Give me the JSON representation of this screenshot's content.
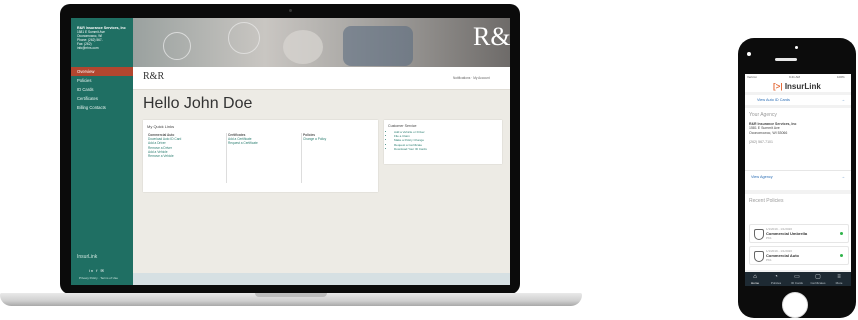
{
  "laptop": {
    "sidebar": {
      "brand_name": "R&R Insurance Services, Inc",
      "brand_lines": [
        "1581 E Summit Ave",
        "Oconomowoc, WI",
        "Phone: (262) 567-",
        "Fax: (262)",
        "info@rrins.com"
      ],
      "items": [
        {
          "label": "Overview",
          "active": true
        },
        {
          "label": "Policies",
          "active": false
        },
        {
          "label": "ID Cards",
          "active": false
        },
        {
          "label": "Certificates",
          "active": false
        },
        {
          "label": "Billing Contacts",
          "active": false
        }
      ],
      "footer_logo": "InsurLink",
      "social": "in f ✉",
      "footer_links": "Privacy Policy · Terms of Use"
    },
    "banner_logo": "R&R",
    "topbar": {
      "logo": "R&R",
      "right_links": "Notifications · My Account"
    },
    "greeting": "Hello John Doe",
    "quick_links": {
      "title": "My Quick Links",
      "columns": [
        {
          "heading": "Commercial Auto",
          "links": [
            "Download Auto ID Card",
            "Add a Driver",
            "Remove a Driver",
            "Add a Vehicle",
            "Remove a Vehicle"
          ]
        },
        {
          "heading": "Certificates",
          "links": [
            "Add a Certificate",
            "Request a Certificate"
          ]
        },
        {
          "heading": "Policies",
          "links": [
            "Change a Policy"
          ]
        }
      ]
    },
    "help": {
      "title": "Customer Service",
      "items": [
        "Add a Vehicle or Driver",
        "File a Claim",
        "Make a Policy Change",
        "Request a Certificate",
        "Download Your ID Cards"
      ]
    }
  },
  "phone": {
    "status_left": "Verizon",
    "status_center": "9:41 AM",
    "status_right": "100%",
    "app_logo_mark": "[>|",
    "app_title": "InsurLink",
    "view_cards": "View Auto ID Cards",
    "your_agency_heading": "Your Agency",
    "agency_name": "R&R Insurance Services, Inc",
    "agency_address1": "1581 E Summit Ave",
    "agency_address2": "Oconomowoc, WI 53066",
    "agency_phone": "(262) 567-7101",
    "view_agency": "View Agency",
    "recent_heading": "Recent Policies",
    "policies": [
      {
        "date": "1/1/2019 - 1/1/2020",
        "name": "Commercial Umbrella",
        "num": "PK1"
      },
      {
        "date": "1/1/2019 - 1/1/2020",
        "name": "Commercial Auto",
        "num": "PK1"
      }
    ],
    "tabs": [
      {
        "icon": "⌂",
        "label": "Home",
        "active": true
      },
      {
        "icon": "◔",
        "label": "Policies",
        "active": false
      },
      {
        "icon": "▭",
        "label": "ID Cards",
        "active": false
      },
      {
        "icon": "▢",
        "label": "Certificates",
        "active": false
      },
      {
        "icon": "≡",
        "label": "More",
        "active": false
      }
    ],
    "colors": {
      "accent": "#e46b3a",
      "link": "#2a6db5",
      "active_dot": "#2fb34a"
    }
  },
  "colors": {
    "sidebar": "#1f6f63",
    "active_nav": "#b2462f",
    "link": "#2a7d70"
  }
}
